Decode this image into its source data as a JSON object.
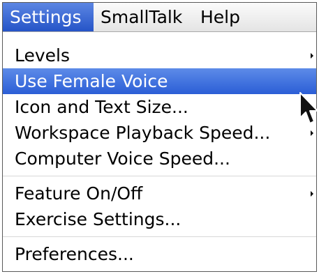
{
  "menubar": {
    "items": [
      {
        "label": "Settings",
        "active": true
      },
      {
        "label": "SmallTalk",
        "active": false
      },
      {
        "label": "Help",
        "active": false
      }
    ]
  },
  "menu": {
    "items": [
      {
        "label": "Levels",
        "has_submenu": true
      },
      {
        "label": "Use Female Voice",
        "highlighted": true
      },
      {
        "label": "Icon and Text Size..."
      },
      {
        "label": "Workspace Playback Speed...",
        "has_submenu": true
      },
      {
        "label": "Computer Voice Speed..."
      },
      {
        "label": "Feature On/Off",
        "has_submenu": true
      },
      {
        "label": "Exercise Settings..."
      },
      {
        "label": "Preferences..."
      }
    ]
  },
  "colors": {
    "highlight": "#3366cc",
    "menubar_bg": "#f0f0f0"
  },
  "icons": {
    "pointer": "mouse-pointer-icon",
    "submenu": "submenu-arrow-icon"
  }
}
